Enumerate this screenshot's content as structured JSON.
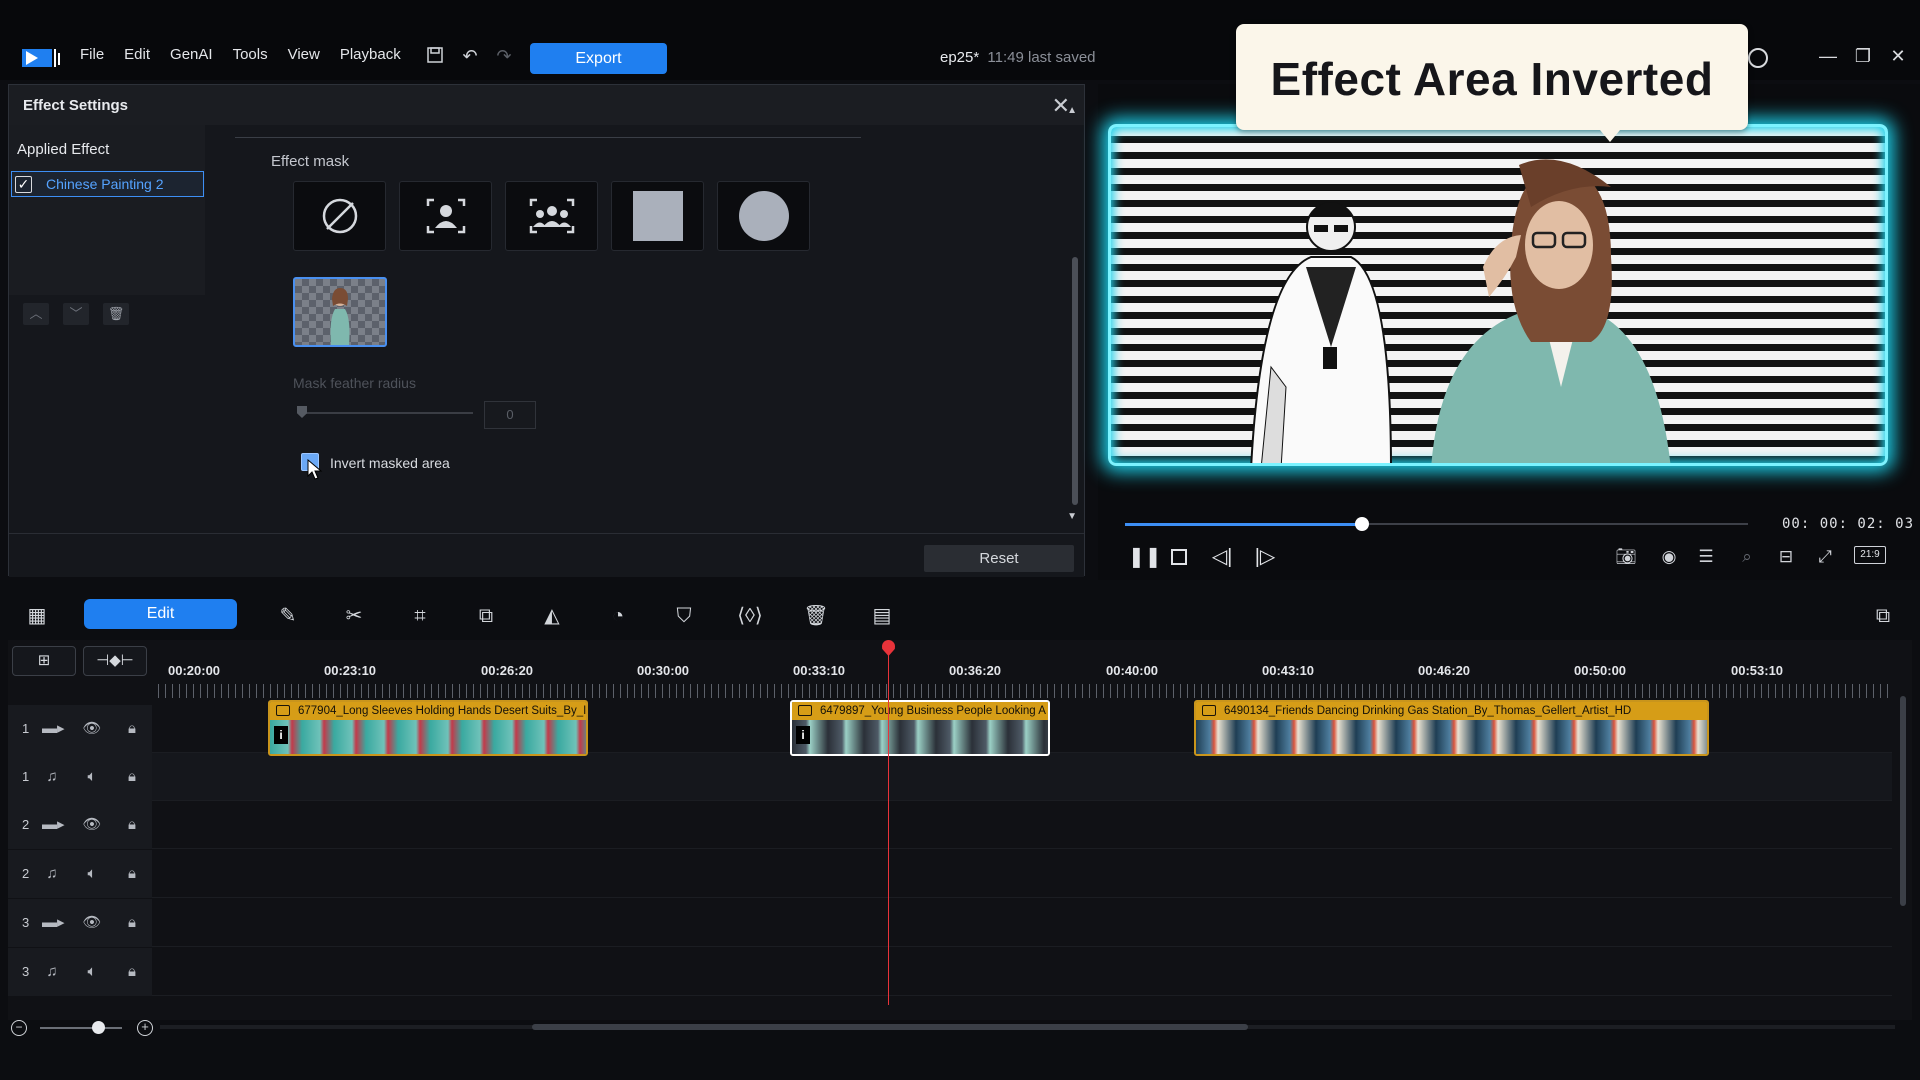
{
  "app": {
    "menu": [
      "File",
      "Edit",
      "GenAI",
      "Tools",
      "View",
      "Playback"
    ],
    "export_label": "Export",
    "project_name": "ep25*",
    "saved_status": "11:49 last saved"
  },
  "effect_settings": {
    "title": "Effect Settings",
    "applied_label": "Applied Effect",
    "applied_item": "Chinese Painting 2",
    "applied_checked": true,
    "mask_label": "Effect mask",
    "mask_options": [
      "none-icon",
      "person-mask-icon",
      "multi-person-mask-icon",
      "square-mask-icon",
      "circle-mask-icon"
    ],
    "feather_label": "Mask feather radius",
    "feather_value": "0",
    "invert_label": "Invert masked area",
    "invert_checked": true,
    "reset_label": "Reset"
  },
  "preview": {
    "callout_text": "Effect Area Inverted",
    "timecode": "00: 00: 02: 03",
    "progress": 0.38,
    "aspect_ratio": "21:9",
    "accent": "#1dcfe8"
  },
  "toolbar": {
    "edit_label": "Edit"
  },
  "timeline": {
    "ruler": [
      "00:20:00",
      "00:23:10",
      "00:26:20",
      "00:30:00",
      "00:33:10",
      "00:36:20",
      "00:40:00",
      "00:43:10",
      "00:46:20",
      "00:50:00",
      "00:53:10"
    ],
    "tracks": [
      {
        "num": "1",
        "type": "video"
      },
      {
        "num": "1",
        "type": "audio"
      },
      {
        "num": "2",
        "type": "video"
      },
      {
        "num": "2",
        "type": "audio"
      },
      {
        "num": "3",
        "type": "video"
      },
      {
        "num": "3",
        "type": "audio"
      }
    ],
    "clips": [
      {
        "title": "677904_Long Sleeves Holding Hands Desert Suits_By_I"
      },
      {
        "title": "6479897_Young Business People Looking A"
      },
      {
        "title": "6490134_Friends Dancing Drinking Gas Station_By_Thomas_Gellert_Artist_HD"
      }
    ],
    "clip_color": "#d69d17"
  }
}
